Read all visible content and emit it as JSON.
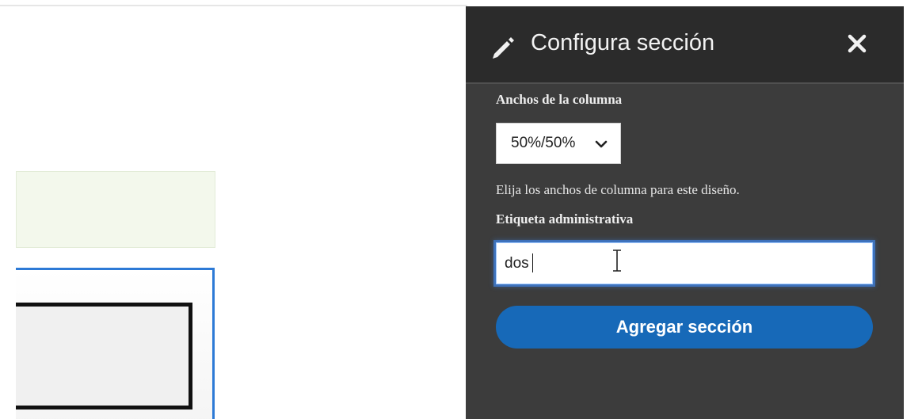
{
  "panel": {
    "title": "Configura sección",
    "icons": {
      "title_icon": "pencil-icon",
      "close": "close-icon"
    }
  },
  "form": {
    "column_widths_label": "Anchos de la columna",
    "column_widths_selected": "50%/50%",
    "column_widths_help": "Elija los anchos de columna para este diseño.",
    "admin_label_label": "Etiqueta administrativa",
    "admin_label_value": "dos",
    "submit_label": "Agregar sección"
  },
  "colors": {
    "panel_bg": "#3c3c3c",
    "header_bg": "#2b2b2b",
    "button": "#1769b8",
    "section_outline": "#2d7ad6"
  }
}
